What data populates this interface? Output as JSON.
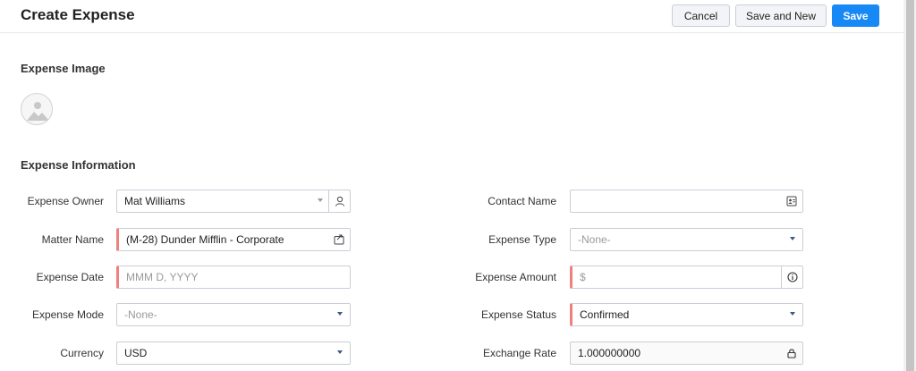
{
  "header": {
    "title": "Create Expense",
    "cancel_label": "Cancel",
    "save_and_new_label": "Save and New",
    "save_label": "Save"
  },
  "sections": {
    "image_title": "Expense Image",
    "info_title": "Expense Information"
  },
  "form": {
    "expense_owner": {
      "label": "Expense Owner",
      "value": "Mat Williams",
      "icon": "user-icon"
    },
    "matter_name": {
      "label": "Matter Name",
      "value": "(M-28) Dunder Mifflin - Corporate",
      "icon": "lookup-icon",
      "required": true
    },
    "expense_date": {
      "label": "Expense Date",
      "placeholder": "MMM D, YYYY",
      "required": true
    },
    "expense_mode": {
      "label": "Expense Mode",
      "value": "-None-"
    },
    "currency": {
      "label": "Currency",
      "value": "USD"
    },
    "contact_name": {
      "label": "Contact Name",
      "value": "",
      "icon": "contact-card-icon"
    },
    "expense_type": {
      "label": "Expense Type",
      "value": "-None-"
    },
    "expense_amount": {
      "label": "Expense Amount",
      "placeholder": "$",
      "icon": "info-icon",
      "required": true
    },
    "expense_status": {
      "label": "Expense Status",
      "value": "Confirmed",
      "required": true
    },
    "exchange_rate": {
      "label": "Exchange Rate",
      "value": "1.000000000",
      "icon": "lock-icon"
    }
  },
  "colors": {
    "primary": "#1789f5",
    "required_marker": "#f08080",
    "dropdown_caret": "#3b5a8a"
  }
}
